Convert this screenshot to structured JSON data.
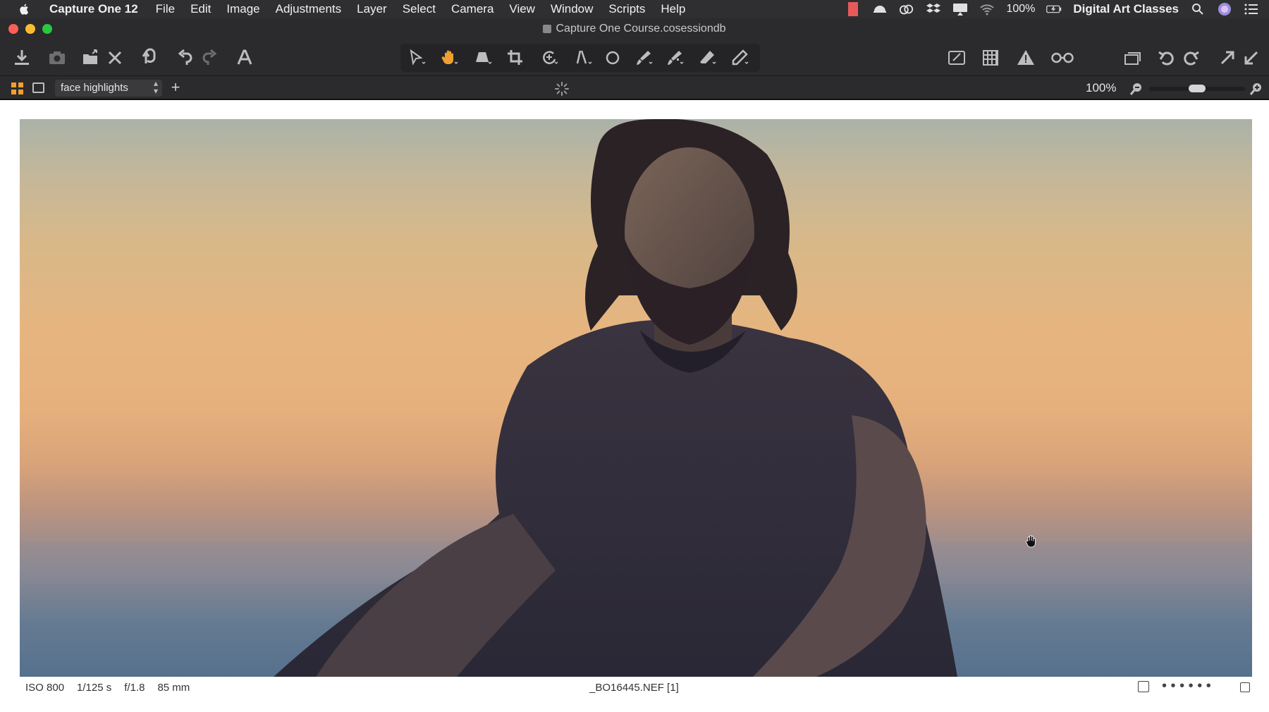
{
  "menubar": {
    "app_name": "Capture One 12",
    "items": [
      "File",
      "Edit",
      "Image",
      "Adjustments",
      "Layer",
      "Select",
      "Camera",
      "View",
      "Window",
      "Scripts",
      "Help"
    ],
    "battery": "100%",
    "user": "Digital Art Classes"
  },
  "window": {
    "title": "Capture One Course.cosessiondb"
  },
  "toolbar": {
    "left_icons": [
      "import-icon",
      "camera-icon",
      "move-to-folder-icon",
      "delete-icon",
      "reset-icon",
      "undo-icon",
      "redo-icon",
      "text-overlay-icon"
    ],
    "cursor_tools": [
      "select-icon",
      "pan-hand-icon",
      "keystone-icon",
      "crop-icon",
      "rotate-icon",
      "straighten-icon",
      "spot-removal-icon",
      "brush-icon",
      "gradient-icon",
      "eraser-icon",
      "pencil-icon"
    ],
    "right_icons": [
      "edit-icon",
      "grid-overlay-icon",
      "exposure-warning-icon",
      "proof-glasses-icon",
      "copy-adjustments-icon",
      "rotate-left-icon",
      "rotate-right-icon",
      "copy-apply-icon",
      "apply-icon"
    ]
  },
  "viewerbar": {
    "style_select": "face highlights",
    "zoom": "100%",
    "zoom_level": 0.5
  },
  "infobar": {
    "iso": "ISO 800",
    "shutter": "1/125 s",
    "aperture": "f/1.8",
    "focal_length": "85 mm",
    "filename": "_BO16445.NEF [1]",
    "rating_dots": "• • • • • •"
  },
  "colors": {
    "menubar": "#2f2f31",
    "toolbar": "#2b2b2d",
    "accent_orange": "#f0a030",
    "icon": "#bdbdbd"
  }
}
